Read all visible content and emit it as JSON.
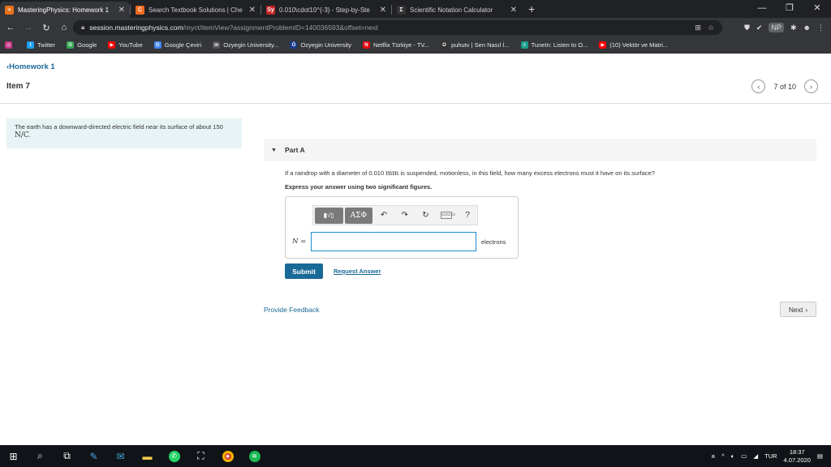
{
  "browser": {
    "tabs": [
      {
        "title": "MasteringPhysics: Homework 1",
        "favicon_color": "#e8711c",
        "favicon_glyph": "≈",
        "active": true
      },
      {
        "title": "Search Textbook Solutions | Che",
        "favicon_color": "#f26b21",
        "favicon_glyph": "C",
        "active": false
      },
      {
        "title": "0.010\\cdot10^{-3} - Step-by-Ste",
        "favicon_color": "#c62828",
        "favicon_glyph": "Sy",
        "active": false
      },
      {
        "title": "Scientific Notation Calculator",
        "favicon_color": "#333333",
        "favicon_glyph": "Σ",
        "active": false
      }
    ],
    "address": {
      "host": "session.masteringphysics.com",
      "path": "/myct/itemView?assignmentProblemID=140036593&offset=next"
    },
    "profile_badge": "NP",
    "bookmarks": [
      {
        "label": "",
        "icon": "instagram-icon",
        "color": "#c13584",
        "glyph": "◎"
      },
      {
        "label": "Twitter",
        "icon": "twitter-icon",
        "color": "#1da1f2",
        "glyph": "t"
      },
      {
        "label": "Google",
        "icon": "google-icon",
        "color": "#34a853",
        "glyph": "G"
      },
      {
        "label": "YouTube",
        "icon": "youtube-icon",
        "color": "#ff0000",
        "glyph": "▶"
      },
      {
        "label": "Google Çeviri",
        "icon": "translate-icon",
        "color": "#4285f4",
        "glyph": "G"
      },
      {
        "label": "Ozyegin University...",
        "icon": "moodle-icon",
        "color": "#555555",
        "glyph": "m"
      },
      {
        "label": "Ozyegin University",
        "icon": "ozu-icon",
        "color": "#1a3d8f",
        "glyph": "Ö"
      },
      {
        "label": "Netflix Türkiye - TV...",
        "icon": "netflix-icon",
        "color": "#e50914",
        "glyph": "N"
      },
      {
        "label": "puhutv | Sen Nasıl İ...",
        "icon": "puhutv-icon",
        "color": "#333333",
        "glyph": "O"
      },
      {
        "label": "TuneIn: Listen to O...",
        "icon": "tunein-icon",
        "color": "#1c9c8c",
        "glyph": "≡"
      },
      {
        "label": "(10) Vektör ve Matri...",
        "icon": "youtube-icon",
        "color": "#ff0000",
        "glyph": "▶"
      }
    ]
  },
  "page": {
    "back_label": "Homework 1",
    "item_title": "Item 7",
    "pager_text": "7 of 10",
    "intro_text": "The earth has a downward-directed electric field near its surface of about 150",
    "intro_unit": "N/C",
    "part_label": "Part A",
    "question_pre": "If a raindrop with a diameter of 0.010",
    "question_unit": "mm",
    "question_post": "is suspended, motionless, in this field, how many excess electrons must it have on its surface?",
    "instruction": "Express your answer using two significant figures.",
    "toolbar": {
      "template_label": "▮√▯",
      "greek_label": "ΑΣΦ",
      "undo": "↶",
      "redo": "↷",
      "reset": "↻",
      "keyboard": "▭▭▭",
      "help": "?"
    },
    "answer": {
      "label": "N =",
      "value": "",
      "unit": "electrons"
    },
    "submit_label": "Submit",
    "request_label": "Request Answer",
    "feedback_label": "Provide Feedback",
    "next_label": "Next"
  },
  "taskbar": {
    "language": "TUR",
    "time": "18:37",
    "date": "4.07.2020"
  }
}
